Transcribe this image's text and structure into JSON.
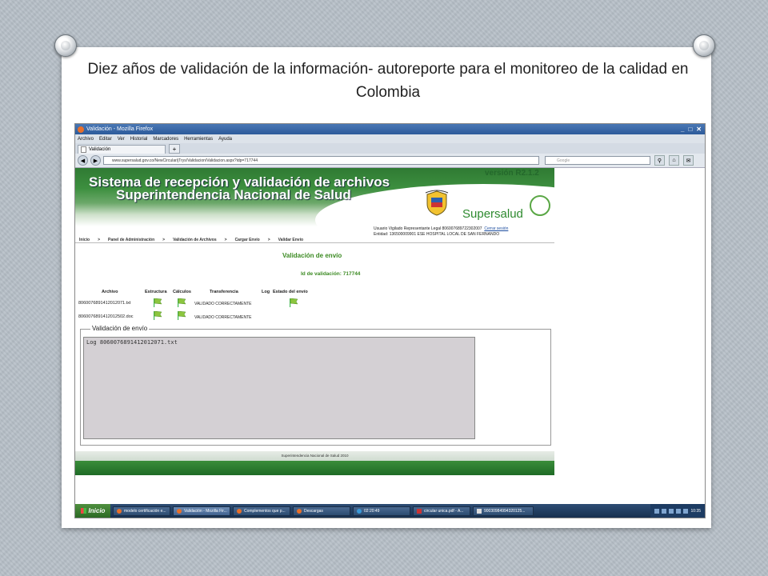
{
  "slide": {
    "title": "Diez años de validación de la información- autoreporte para el monitoreo de la calidad en Colombia"
  },
  "browser": {
    "window_title": "Validación - Mozilla Firefox",
    "window_buttons": [
      "_",
      "□",
      "✕"
    ],
    "menu": [
      "Archivo",
      "Editar",
      "Ver",
      "Historial",
      "Marcadores",
      "Herramientas",
      "Ayuda"
    ],
    "tab_label": "Validación",
    "tab_plus": "+",
    "url": "www.supersalud.gov.co/NewCircular/jTrys/Validacion/Validacion.aspx?idp=717744",
    "search_placeholder": "Google"
  },
  "banner": {
    "title_line1": "Sistema de recepción y validación de archivos",
    "title_line2": "Superintendencia Nacional de Salud",
    "version": "versión R2.1.2",
    "brand": "Supersalud"
  },
  "user": {
    "line1": "Usuario Vigilado Representante Legal     806007689722302007",
    "cerrar": "Cerrar sesión",
    "line2": "Entidad: 136500009901     ESE HOSPITAL LOCAL DE SAN FERNANDO"
  },
  "breadcrumb": [
    "Inicio",
    ">",
    "Panel de Administración",
    ">",
    "Validación de Archivos",
    ">",
    "Cargar Envío",
    ">",
    "Validar Envío"
  ],
  "page": {
    "heading": "Validación de envío",
    "id_label": "Id de validación: 717744"
  },
  "table": {
    "headers": [
      "Archivo",
      "Estructura",
      "Cálculos",
      "Transferencia",
      "Log",
      "Estado del envío"
    ],
    "rows": [
      {
        "file": "8060076891412012071.txt",
        "status": "VALIDADO CORRECTAMENTE"
      },
      {
        "file": "8060076891412012502.doc",
        "status": "VALIDADO CORRECTAMENTE"
      }
    ]
  },
  "fieldset": {
    "legend": "Validación de envío",
    "log_text": "Log 8060076891412012071.txt"
  },
  "footer": {
    "text": "Superintendencia Nacional de Salud 2010"
  },
  "taskbar": {
    "start": "Inicio",
    "items": [
      {
        "label": "modelo certificación e...",
        "active": false
      },
      {
        "label": "Validación - Mozilla Fir...",
        "active": true
      },
      {
        "label": "Complementos que p...",
        "active": false
      },
      {
        "label": "Descargas",
        "active": false
      },
      {
        "label": "02:20:49",
        "active": false
      },
      {
        "label": "circular unica.pdf - A...",
        "active": false
      },
      {
        "label": "90030984994320125...",
        "active": false
      }
    ],
    "clock": "10:35"
  },
  "colors": {
    "banner_green": "#2f7a33",
    "heading_green": "#3b8a22",
    "taskbar": "#1d3c63"
  }
}
